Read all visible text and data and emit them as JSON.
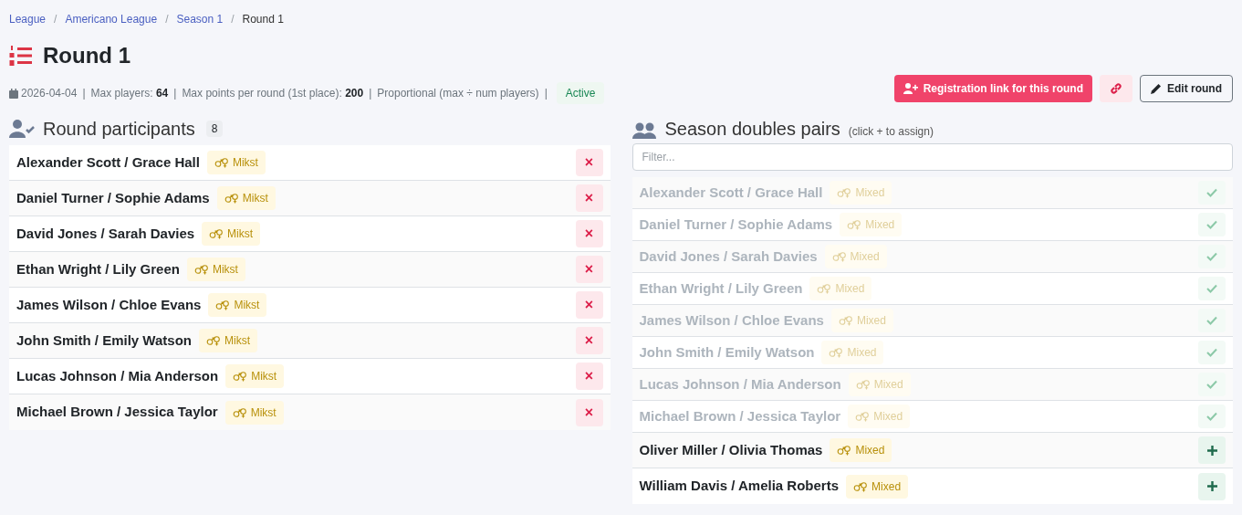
{
  "breadcrumb": [
    {
      "kind": "link",
      "label": "League"
    },
    {
      "kind": "separator",
      "label": "/"
    },
    {
      "kind": "link",
      "label": "Americano League"
    },
    {
      "kind": "separator",
      "label": "/"
    },
    {
      "kind": "link",
      "label": "Season 1"
    },
    {
      "kind": "separator",
      "label": "/"
    },
    {
      "kind": "current",
      "label": "Round 1"
    }
  ],
  "title": "Round 1",
  "meta": [
    {
      "kind": "date",
      "text": "2026-04-04"
    },
    {
      "kind": "separator",
      "text": "|"
    },
    {
      "kind": "stat",
      "text": "Max players:",
      "value": "64"
    },
    {
      "kind": "separator",
      "text": "|"
    },
    {
      "kind": "stat",
      "text": "Max points per round (1st place):",
      "value": "200"
    },
    {
      "kind": "separator",
      "text": "|"
    },
    {
      "kind": "text",
      "text": "Proportional (max ÷ num players)"
    },
    {
      "kind": "separator",
      "text": "|"
    },
    {
      "kind": "status",
      "text": "Active"
    }
  ],
  "actions": {
    "registration": "Registration link for this round",
    "edit": "Edit round"
  },
  "participants": {
    "title": "Round participants",
    "count": "8",
    "rows": [
      {
        "name": "Alexander Scott / Grace Hall",
        "badge": "Mikst",
        "remove": "×"
      },
      {
        "name": "Daniel Turner / Sophie Adams",
        "badge": "Mikst",
        "remove": "×"
      },
      {
        "name": "David Jones / Sarah Davies",
        "badge": "Mikst",
        "remove": "×"
      },
      {
        "name": "Ethan Wright / Lily Green",
        "badge": "Mikst",
        "remove": "×"
      },
      {
        "name": "James Wilson / Chloe Evans",
        "badge": "Mikst",
        "remove": "×"
      },
      {
        "name": "John Smith / Emily Watson",
        "badge": "Mikst",
        "remove": "×"
      },
      {
        "name": "Lucas Johnson / Mia Anderson",
        "badge": "Mikst",
        "remove": "×"
      },
      {
        "name": "Michael Brown / Jessica Taylor",
        "badge": "Mikst",
        "remove": "×"
      }
    ]
  },
  "pairs": {
    "title": "Season doubles pairs",
    "hint": "(click + to assign)",
    "filter_placeholder": "Filter...",
    "rows": [
      {
        "name": "Alexander Scott / Grace Hall",
        "badge": "Mixed",
        "assigned": true
      },
      {
        "name": "Daniel Turner / Sophie Adams",
        "badge": "Mixed",
        "assigned": true
      },
      {
        "name": "David Jones / Sarah Davies",
        "badge": "Mixed",
        "assigned": true
      },
      {
        "name": "Ethan Wright / Lily Green",
        "badge": "Mixed",
        "assigned": true
      },
      {
        "name": "James Wilson / Chloe Evans",
        "badge": "Mixed",
        "assigned": true
      },
      {
        "name": "John Smith / Emily Watson",
        "badge": "Mixed",
        "assigned": true
      },
      {
        "name": "Lucas Johnson / Mia Anderson",
        "badge": "Mixed",
        "assigned": true
      },
      {
        "name": "Michael Brown / Jessica Taylor",
        "badge": "Mixed",
        "assigned": true
      },
      {
        "name": "Oliver Miller / Olivia Thomas",
        "badge": "Mixed",
        "assigned": false
      },
      {
        "name": "William Davis / Amelia Roberts",
        "badge": "Mixed",
        "assigned": false
      }
    ]
  }
}
